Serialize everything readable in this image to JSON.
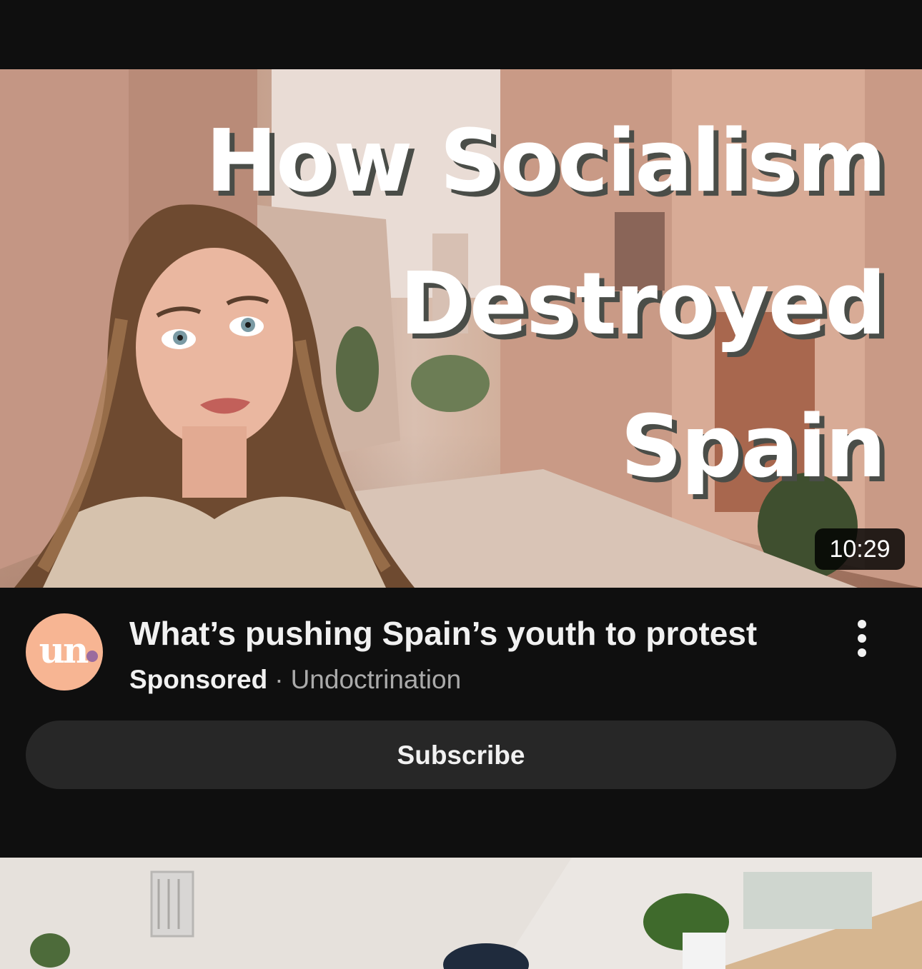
{
  "video": {
    "thumbnail_text": [
      "How Socialism",
      "Destroyed",
      "Spain"
    ],
    "duration": "10:29",
    "title": "What’s pushing Spain’s youth to protest",
    "sponsored_label": "Sponsored",
    "separator": "·",
    "channel": "Undoctrination",
    "avatar_text": "un"
  },
  "actions": {
    "subscribe_label": "Subscribe",
    "more_icon": "vertical-ellipsis-icon"
  },
  "colors": {
    "background": "#0f0f0f",
    "avatar_bg": "#f7b593",
    "avatar_dot": "#9b6b9e",
    "button_bg": "#272727",
    "secondary_text": "#aaaaaa"
  }
}
